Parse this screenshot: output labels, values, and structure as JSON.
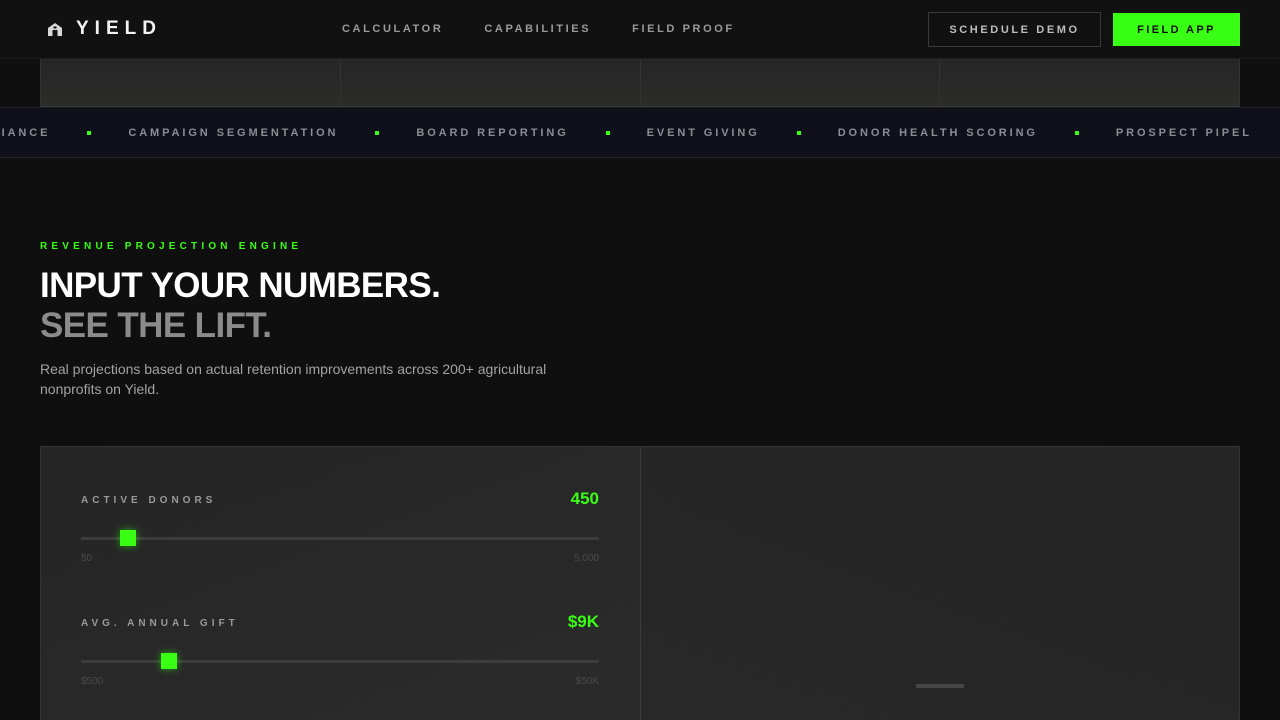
{
  "nav": {
    "brand": "YIELD",
    "links": [
      "CALCULATOR",
      "CAPABILITIES",
      "FIELD PROOF"
    ],
    "demo_label": "SCHEDULE DEMO",
    "app_label": "FIELD APP"
  },
  "ticker": {
    "items": [
      "LIANCE",
      "CAMPAIGN SEGMENTATION",
      "BOARD REPORTING",
      "EVENT GIVING",
      "DONOR HEALTH SCORING",
      "PROSPECT PIPEL"
    ]
  },
  "hero": {
    "eyebrow": "REVENUE PROJECTION ENGINE",
    "headline_1": "INPUT YOUR NUMBERS.",
    "headline_2": "SEE THE LIFT.",
    "subhead": "Real projections based on actual retention improvements across 200+ agricultural nonprofits on Yield."
  },
  "calculator": {
    "fields": [
      {
        "label": "ACTIVE DONORS",
        "value": "450",
        "min": "50",
        "max": "5,000",
        "level": 0.09
      },
      {
        "label": "AVG. ANNUAL GIFT",
        "value": "$9K",
        "min": "$500",
        "max": "$50K",
        "level": 0.17
      }
    ]
  },
  "colors": {
    "accent": "#39ff14",
    "background": "#0f0f0f",
    "panel": "#232323"
  },
  "icons": {
    "logo": "barn-icon"
  }
}
